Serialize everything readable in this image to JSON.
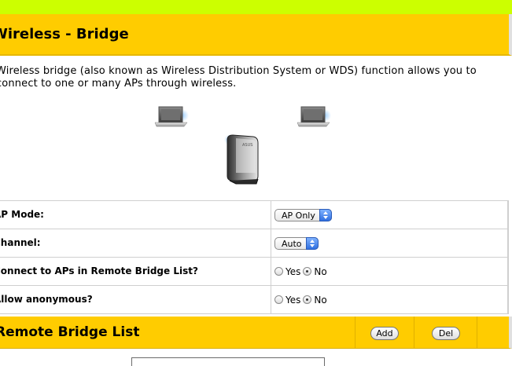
{
  "header": {
    "title": "Wireless - Bridge"
  },
  "description": "Wireless bridge (also known as Wireless Distribution System or WDS) function allows you to connect to one or many APs through wireless.",
  "illustration": {
    "router_brand": "ASUS"
  },
  "settings": {
    "ap_mode": {
      "label": "AP Mode:",
      "value": "AP Only"
    },
    "channel": {
      "label": "Channel:",
      "value": "Auto"
    },
    "connect_remote": {
      "label": "Connect to APs in Remote Bridge List?",
      "yes": "Yes",
      "no": "No",
      "selected": "No"
    },
    "anonymous": {
      "label": "Allow anonymous?",
      "yes": "Yes",
      "no": "No",
      "selected": "No"
    }
  },
  "remote_bridge": {
    "title": "Remote Bridge List",
    "add_label": "Add",
    "del_label": "Del"
  },
  "colors": {
    "accent": "#ffcc00",
    "top_band": "#ccff00"
  },
  "icons": [
    "laptop-icon",
    "laptop-icon",
    "router-icon",
    "chevron-updown-icon"
  ]
}
